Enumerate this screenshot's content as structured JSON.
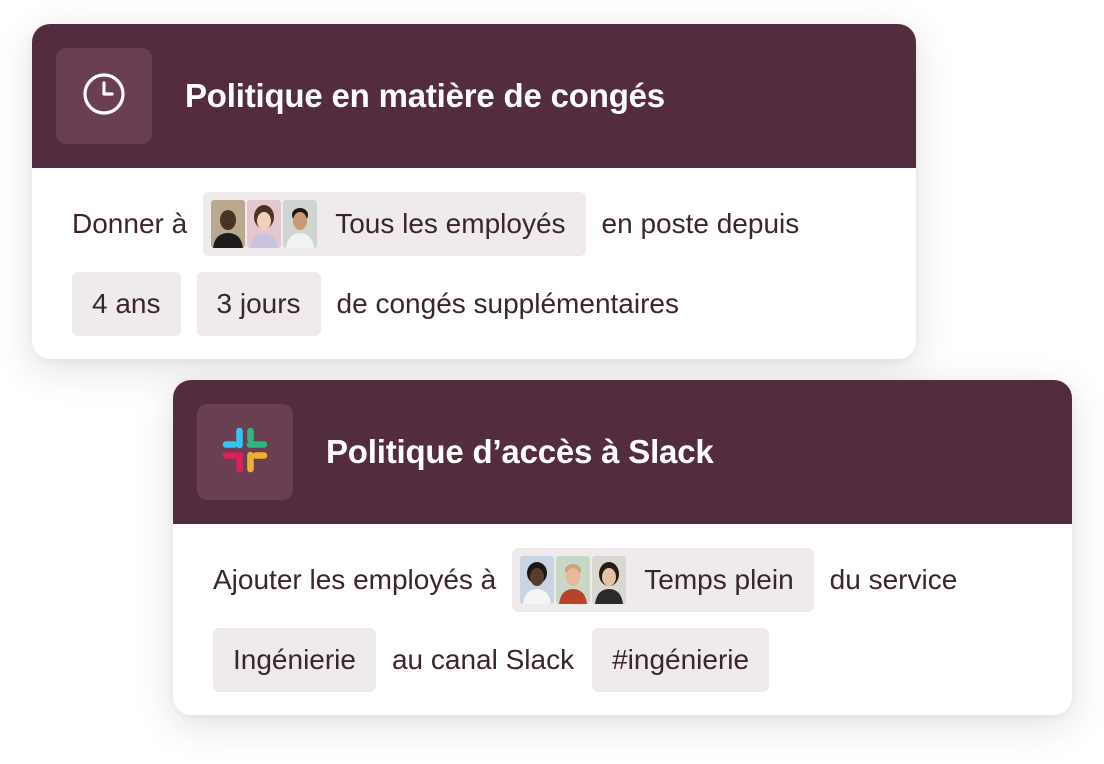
{
  "cards": [
    {
      "title": "Politique en matière de congés",
      "icon": "clock-icon",
      "line1": {
        "prefix": "Donner à",
        "group": "Tous les employés",
        "suffix": "en poste depuis"
      },
      "line2": {
        "tenure": "4 ans",
        "days": "3 jours",
        "suffix": "de congés supplémentaires"
      }
    },
    {
      "title": "Politique d’accès à Slack",
      "icon": "slack-logo-icon",
      "line1": {
        "prefix": "Ajouter les employés à",
        "group": "Temps plein",
        "suffix": "du service"
      },
      "line2": {
        "department": "Ingénierie",
        "middle": "au canal Slack",
        "channel": "#ingénierie"
      }
    }
  ],
  "colors": {
    "header_bg": "#542c3f",
    "icon_tile_bg": "#6a3f51",
    "chip_bg": "#efebec",
    "text": "#3a2430",
    "slack": [
      "#36c5f0",
      "#2eb67d",
      "#ecb22e",
      "#e01e5a"
    ]
  }
}
